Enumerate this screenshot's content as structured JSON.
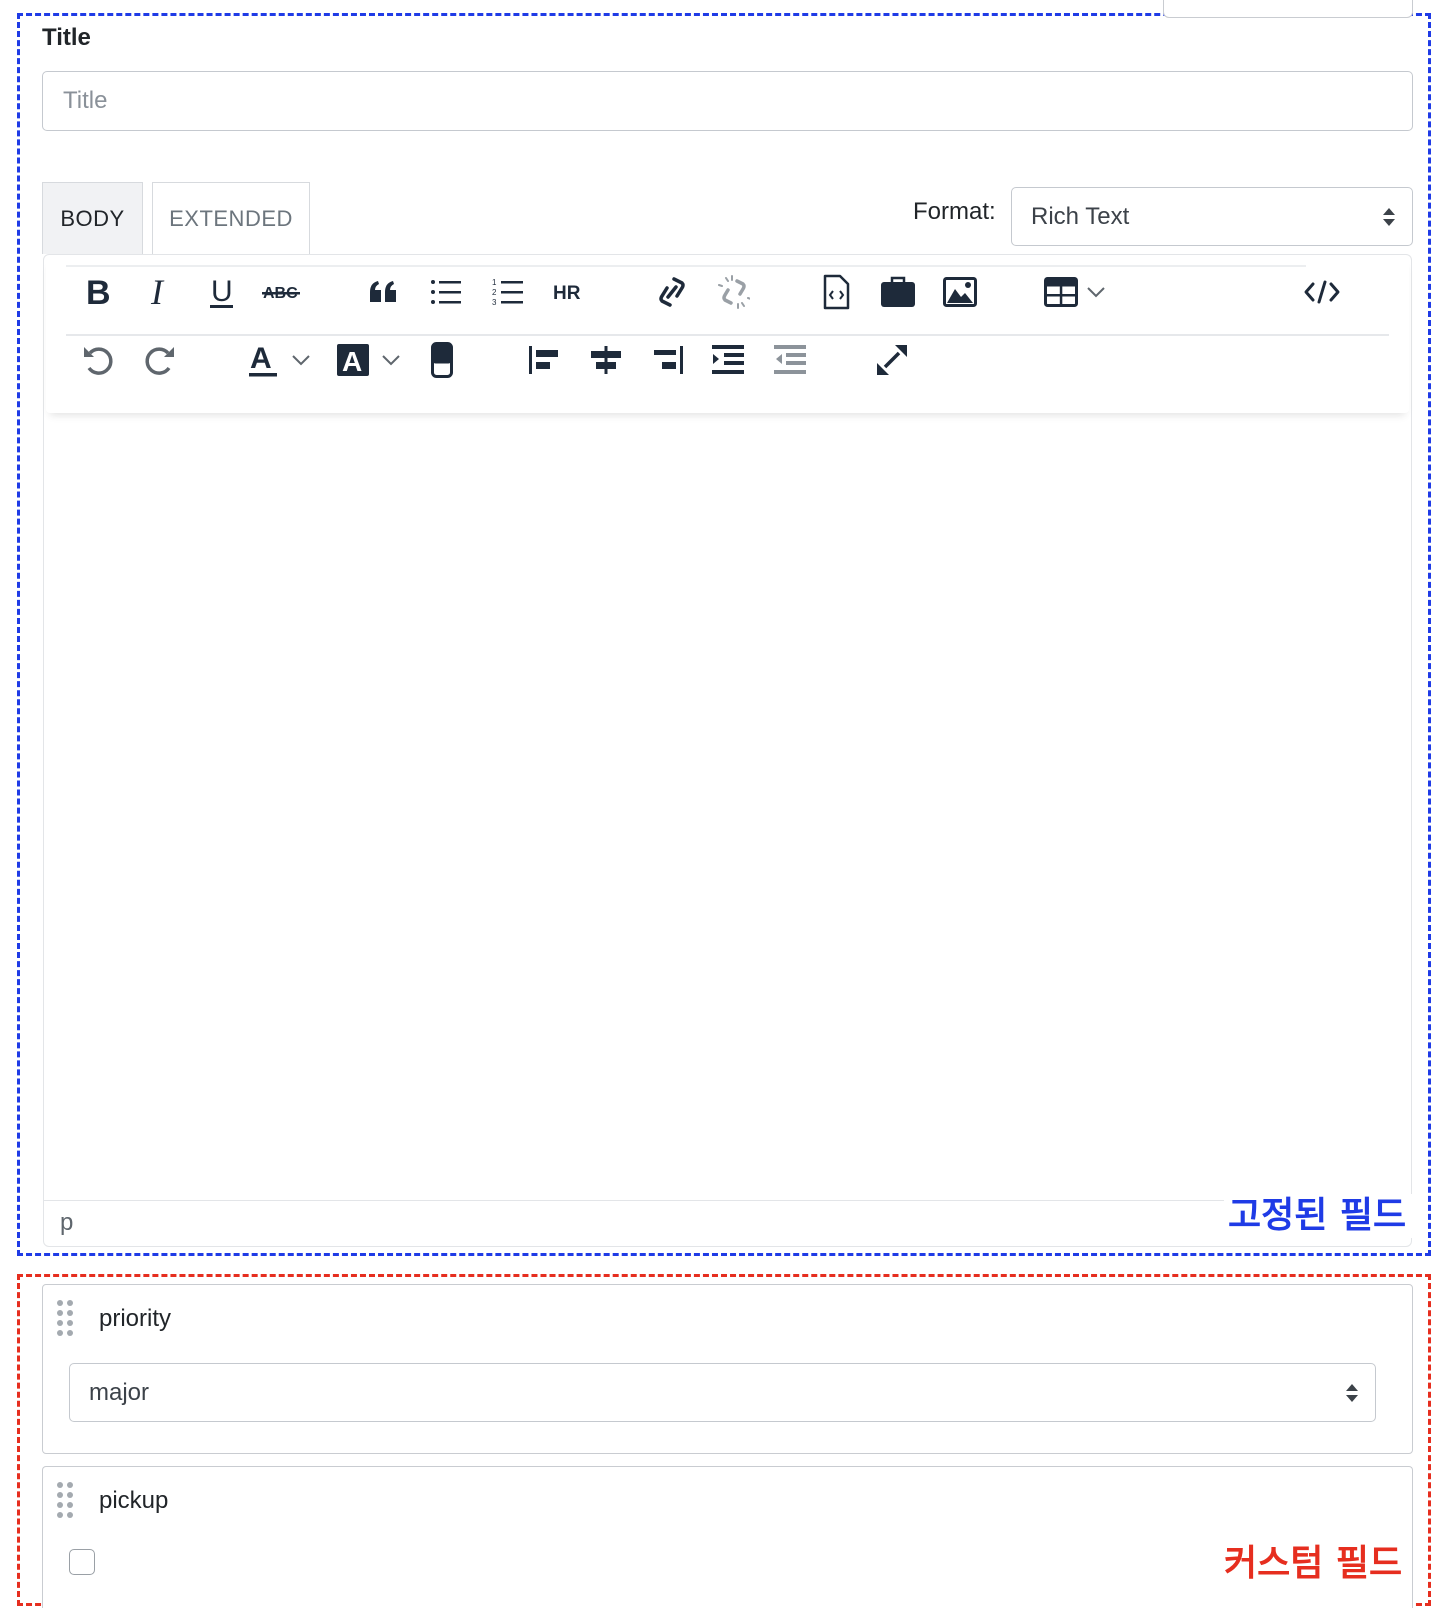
{
  "title_field": {
    "label": "Title",
    "placeholder": "Title",
    "value": ""
  },
  "tabs": [
    {
      "label": "BODY",
      "active": true
    },
    {
      "label": "EXTENDED",
      "active": false
    }
  ],
  "format": {
    "label": "Format:",
    "selected": "Rich Text"
  },
  "toolbar": {
    "row1": [
      "bold-icon",
      "italic-icon",
      "underline-icon",
      "strikethrough-icon",
      "blockquote-icon",
      "bullet-list-icon",
      "numbered-list-icon",
      "horizontal-rule-icon",
      "link-icon",
      "unlink-icon",
      "code-sample-icon",
      "media-icon",
      "image-icon",
      "table-icon",
      "source-code-icon"
    ],
    "row2": [
      "undo-icon",
      "redo-icon",
      "text-color-icon",
      "background-color-icon",
      "anchor-icon",
      "align-left-icon",
      "align-center-icon",
      "align-right-icon",
      "indent-icon",
      "outdent-icon",
      "fullscreen-icon"
    ],
    "strike_text": "ABC",
    "hr_text": "HR"
  },
  "editor": {
    "content": "",
    "status_path": "p"
  },
  "annotations": {
    "fixed_fields": {
      "text": "고정된 필드",
      "color": "#1f3be6"
    },
    "custom_fields": {
      "text": "커스텀 필드",
      "color": "#e62e1f"
    }
  },
  "custom_fields": [
    {
      "name": "priority",
      "type": "select",
      "selected": "major"
    },
    {
      "name": "pickup",
      "type": "checkbox",
      "checked": false
    }
  ],
  "colors": {
    "icon": "#1e2a3a",
    "icon_disabled": "#9aa0a6",
    "border": "#c5c9cf"
  }
}
